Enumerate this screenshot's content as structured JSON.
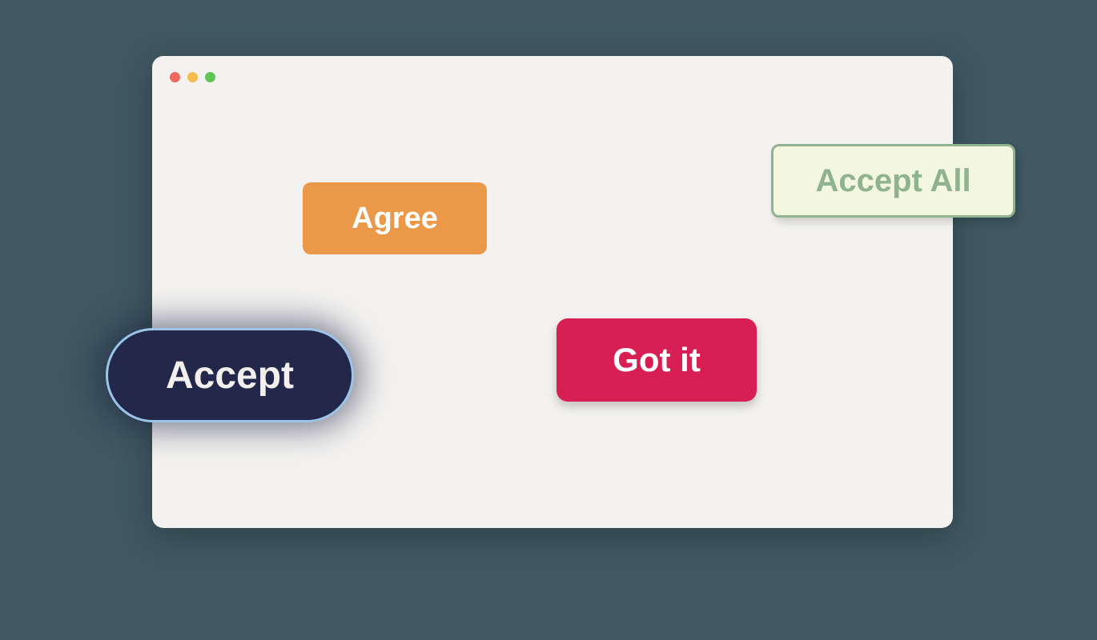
{
  "buttons": {
    "agree": "Agree",
    "accept_all": "Accept All",
    "got_it": "Got it",
    "accept": "Accept"
  }
}
